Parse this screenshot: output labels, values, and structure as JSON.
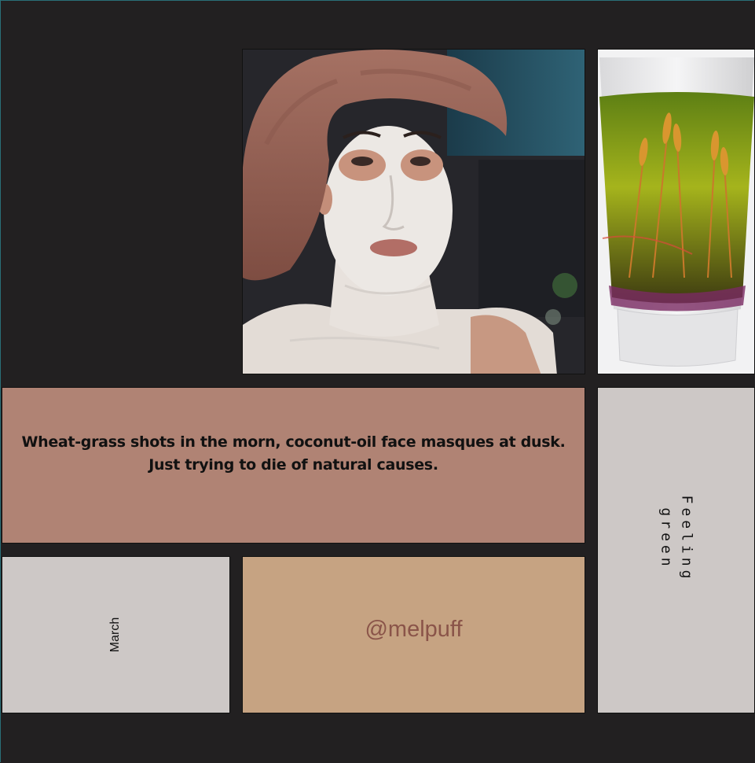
{
  "photos": {
    "face": {
      "alt": "face-mask-photo"
    },
    "shot": {
      "alt": "wheatgrass-shot-photo"
    }
  },
  "quote": {
    "line1": "Wheat-grass shots in the morn, coconut-oil face masques at dusk.",
    "line2": "Just trying to die of natural causes."
  },
  "month": "March",
  "handle": "@melpuff",
  "feeling": {
    "line1": "Feeling",
    "line2": "green"
  },
  "colors": {
    "background": "#222021",
    "quote_card": "#b08374",
    "grey_card": "#cdc8c6",
    "handle_card": "#c6a382",
    "handle_text": "#8a5449"
  }
}
